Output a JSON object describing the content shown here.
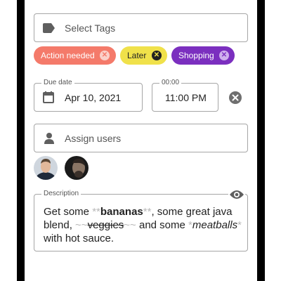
{
  "tags": {
    "placeholder": "Select Tags",
    "chips": [
      {
        "label": "Action needed",
        "color": "#f47a6a",
        "text_color": "#ffffff"
      },
      {
        "label": "Later",
        "color": "#f0e14a",
        "text_color": "#222222"
      },
      {
        "label": "Shopping",
        "color": "#7b2fbf",
        "text_color": "#ffffff"
      }
    ]
  },
  "due": {
    "date_legend": "Due date",
    "date_value": "Apr 10, 2021",
    "time_legend": "00:00",
    "time_value": "11:00 PM"
  },
  "assign": {
    "placeholder": "Assign users"
  },
  "description": {
    "legend": "Description",
    "parts": {
      "t1": "Get some ",
      "b_mark_open": "**",
      "bold": "bananas",
      "b_mark_close": "**",
      "t2": ", some great java blend, ",
      "s_mark_open": "~~",
      "strike": "veggies",
      "s_mark_close": "~~",
      "t3": " and some ",
      "i_mark_open": "*",
      "italic": "meatballs",
      "i_mark_close": "*",
      "t4": " with hot sauce."
    }
  },
  "icons": [
    "label-icon",
    "calendar-icon",
    "clear-icon",
    "person-icon",
    "eye-icon"
  ]
}
